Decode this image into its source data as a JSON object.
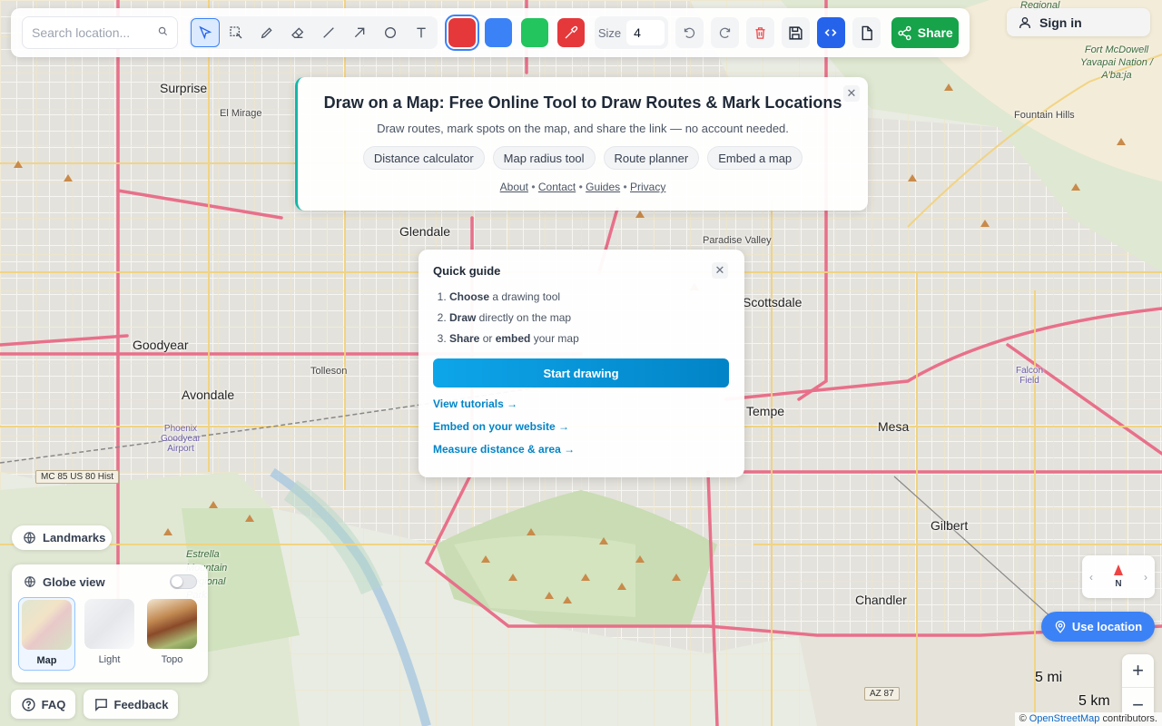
{
  "search": {
    "placeholder": "Search location..."
  },
  "toolbar": {
    "tools": [
      "select-tool",
      "marquee-select-tool",
      "pencil-tool",
      "eraser-tool",
      "line-tool",
      "arrow-tool",
      "circle-tool",
      "text-tool"
    ],
    "colors": [
      "#e5383b",
      "#3b82f6",
      "#22c55e"
    ],
    "picker_color": "#e5383b",
    "size_label": "Size",
    "size_value": "4",
    "share_label": "Share"
  },
  "header": {
    "signin_label": "Sign in"
  },
  "title_card": {
    "title": "Draw on a Map: Free Online Tool to Draw Routes & Mark Locations",
    "subtitle": "Draw routes, mark spots on the map, and share the link — no account needed.",
    "pills": [
      "Distance calculator",
      "Map radius tool",
      "Route planner",
      "Embed a map"
    ],
    "links": [
      "About",
      "Contact",
      "Guides",
      "Privacy"
    ]
  },
  "guide": {
    "title": "Quick guide",
    "steps": [
      {
        "bold": "Choose",
        "rest": " a drawing tool"
      },
      {
        "bold": "Draw",
        "rest": " directly on the map"
      },
      {
        "bold": "Share",
        "mid": " or ",
        "bold2": "embed",
        "rest": " your map"
      }
    ],
    "start_label": "Start drawing",
    "links": [
      "View tutorials →",
      "Embed on your website →",
      "Measure distance & area →"
    ]
  },
  "layers": {
    "landmarks_label": "Landmarks",
    "globe_label": "Globe view",
    "globe_on": false,
    "options": [
      "Map",
      "Light",
      "Topo"
    ],
    "selected": "Map"
  },
  "footer": {
    "faq_label": "FAQ",
    "feedback_label": "Feedback"
  },
  "map_controls": {
    "compass_label": "N",
    "use_location_label": "Use location",
    "zoom_in": "+",
    "zoom_out": "−",
    "scale_imperial": "5 mi",
    "scale_metric": "5 km",
    "attribution_prefix": "© ",
    "attribution_link": "OpenStreetMap",
    "attribution_suffix": " contributors."
  },
  "map_labels": {
    "cities": [
      "Surprise",
      "El Mirage",
      "Glendale",
      "Paradise Valley",
      "Scottsdale",
      "Goodyear",
      "Tolleson",
      "Avondale",
      "Tempe",
      "Mesa",
      "Gilbert",
      "Chandler",
      "Fountain Hills"
    ],
    "areas": [
      "Regional",
      "Fort McDowell Yavapai Nation / A'ba:ja",
      "Estrella Mountain Regional Park"
    ],
    "airports": [
      "Phoenix Goodyear Airport",
      "Falcon Field"
    ],
    "shields": [
      "MC 85 US 80 Hist",
      "AZ 87"
    ]
  }
}
